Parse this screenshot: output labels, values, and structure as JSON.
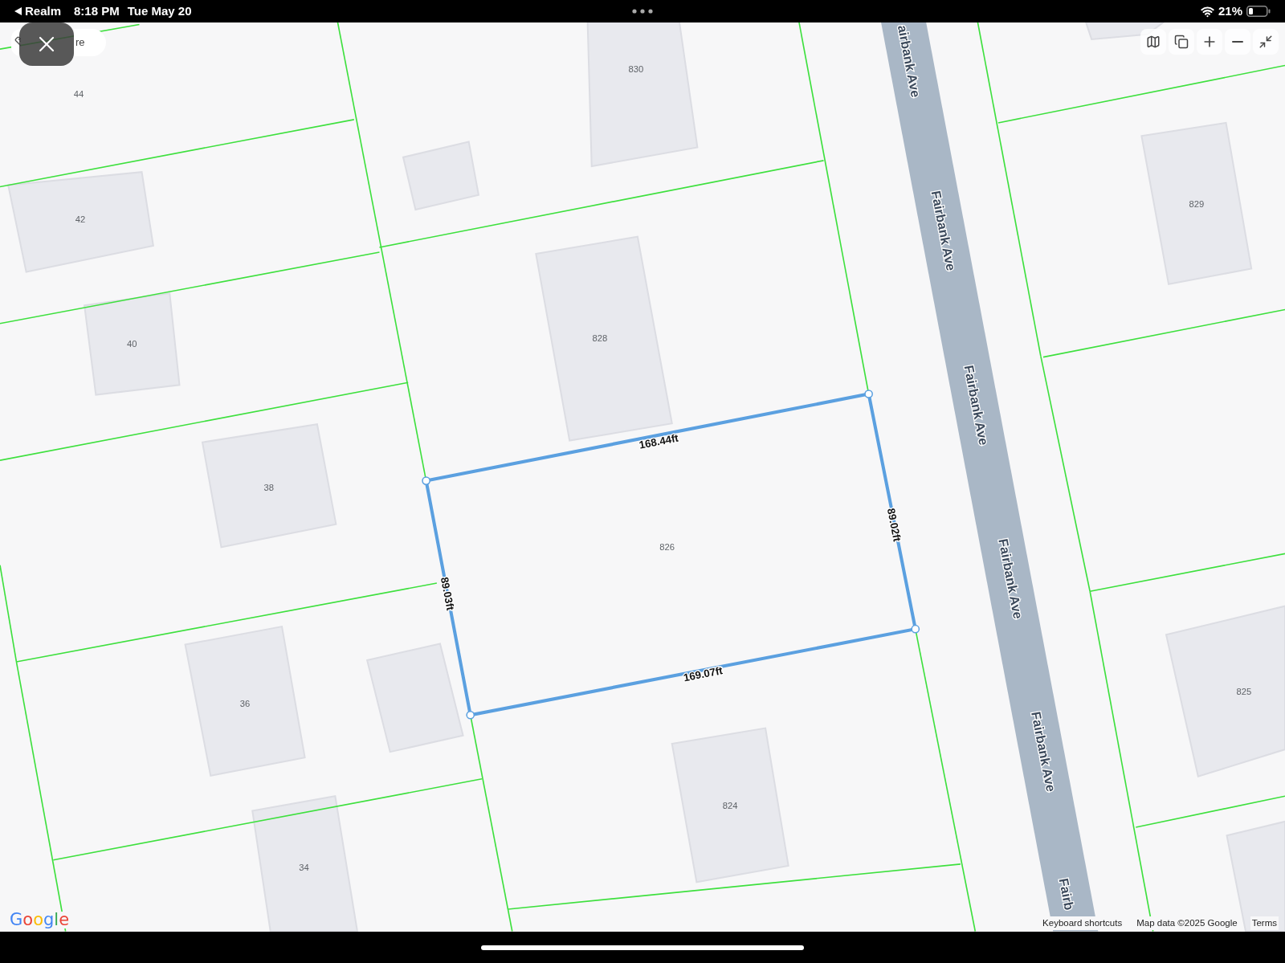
{
  "status_bar": {
    "back_label": "Realm",
    "time": "8:18 PM",
    "date": "Tue May 20",
    "battery": "21%"
  },
  "map": {
    "search": {
      "value": "re"
    },
    "street_labels": [
      "airbank Ave",
      "Fairbank Ave",
      "Fairbank Ave",
      "Fairbank Ave",
      "Fairbank Ave",
      "Fairb"
    ],
    "house_numbers": [
      "44",
      "830",
      "829",
      "42",
      "828",
      "40",
      "38",
      "825",
      "36",
      "824",
      "34"
    ],
    "lot": {
      "number": "826",
      "sides": [
        "168.44ft",
        "89.02ft",
        "169.07ft",
        "89.03ft"
      ]
    },
    "logo": "Google",
    "attribution": [
      "Keyboard shortcuts",
      "Map data ©2025 Google",
      "Terms"
    ]
  }
}
